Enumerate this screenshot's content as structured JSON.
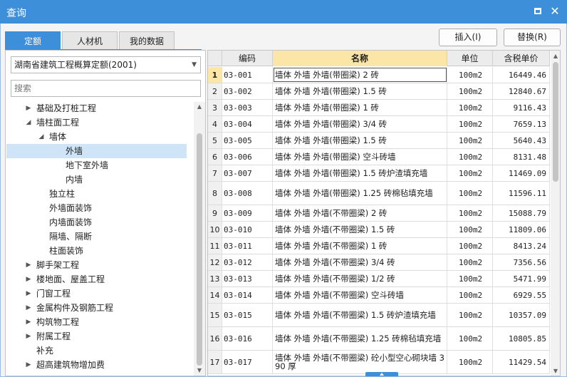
{
  "window": {
    "title": "查询",
    "maximize_icon": "maximize-icon",
    "close_icon": "close-icon",
    "accent": "#3c8fd8"
  },
  "tabs": [
    {
      "label": "定额",
      "active": true
    },
    {
      "label": "人材机",
      "active": false
    },
    {
      "label": "我的数据",
      "active": false
    }
  ],
  "actions": {
    "insert_label": "插入(I)",
    "replace_label": "替换(R)"
  },
  "left": {
    "library_value": "湖南省建筑工程概算定额(2001)",
    "search_placeholder": "搜索",
    "tree": [
      {
        "label": "基础及打桩工程",
        "level": 1,
        "state": "collapsed"
      },
      {
        "label": "墙柱面工程",
        "level": 1,
        "state": "expanded"
      },
      {
        "label": "墙体",
        "level": 2,
        "state": "expanded"
      },
      {
        "label": "外墙",
        "level": 3,
        "state": "leaf",
        "selected": true
      },
      {
        "label": "地下室外墙",
        "level": 3,
        "state": "leaf"
      },
      {
        "label": "内墙",
        "level": 3,
        "state": "leaf"
      },
      {
        "label": "独立柱",
        "level": 2,
        "state": "leaf"
      },
      {
        "label": "外墙面装饰",
        "level": 2,
        "state": "leaf"
      },
      {
        "label": "内墙面装饰",
        "level": 2,
        "state": "leaf"
      },
      {
        "label": "隔墙、隔断",
        "level": 2,
        "state": "leaf"
      },
      {
        "label": "柱面装饰",
        "level": 2,
        "state": "leaf"
      },
      {
        "label": "脚手架工程",
        "level": 1,
        "state": "collapsed"
      },
      {
        "label": "楼地面、屋盖工程",
        "level": 1,
        "state": "collapsed"
      },
      {
        "label": "门窗工程",
        "level": 1,
        "state": "collapsed"
      },
      {
        "label": "金属构件及钢筋工程",
        "level": 1,
        "state": "collapsed"
      },
      {
        "label": "构筑物工程",
        "level": 1,
        "state": "collapsed"
      },
      {
        "label": "附属工程",
        "level": 1,
        "state": "collapsed"
      },
      {
        "label": "补充",
        "level": 1,
        "state": "leaf"
      },
      {
        "label": "超高建筑物增加费",
        "level": 1,
        "state": "collapsed"
      }
    ]
  },
  "grid": {
    "columns": [
      "编码",
      "名称",
      "单位",
      "含税单价"
    ],
    "rows": [
      {
        "num": "1",
        "code": "03-001",
        "name": "墙体 外墙 外墙(带圈梁) 2 砖",
        "unit": "100m2",
        "price": "16449.46",
        "tall": false
      },
      {
        "num": "2",
        "code": "03-002",
        "name": "墙体 外墙 外墙(带圈梁) 1.5 砖",
        "unit": "100m2",
        "price": "12840.67",
        "tall": false
      },
      {
        "num": "3",
        "code": "03-003",
        "name": "墙体 外墙 外墙(带圈梁) 1 砖",
        "unit": "100m2",
        "price": "9116.43",
        "tall": false
      },
      {
        "num": "4",
        "code": "03-004",
        "name": "墙体 外墙 外墙(带圈梁) 3/4 砖",
        "unit": "100m2",
        "price": "7659.13",
        "tall": false
      },
      {
        "num": "5",
        "code": "03-005",
        "name": "墙体 外墙 外墙(带圈梁) 1.5 砖",
        "unit": "100m2",
        "price": "5640.43",
        "tall": false
      },
      {
        "num": "6",
        "code": "03-006",
        "name": "墙体 外墙 外墙(带圈梁) 空斗砖墙",
        "unit": "100m2",
        "price": "8131.48",
        "tall": false
      },
      {
        "num": "7",
        "code": "03-007",
        "name": "墙体 外墙 外墙(带圈梁) 1.5 砖炉渣填充墙",
        "unit": "100m2",
        "price": "11469.09",
        "tall": false
      },
      {
        "num": "8",
        "code": "03-008",
        "name": "墙体 外墙 外墙(带圈梁) 1.25 砖棉毡填充墙",
        "unit": "100m2",
        "price": "11596.11",
        "tall": true
      },
      {
        "num": "9",
        "code": "03-009",
        "name": "墙体 外墙 外墙(不带圈梁) 2 砖",
        "unit": "100m2",
        "price": "15088.79",
        "tall": false
      },
      {
        "num": "10",
        "code": "03-010",
        "name": "墙体 外墙 外墙(不带圈梁) 1.5 砖",
        "unit": "100m2",
        "price": "11809.06",
        "tall": false
      },
      {
        "num": "11",
        "code": "03-011",
        "name": "墙体 外墙 外墙(不带圈梁) 1 砖",
        "unit": "100m2",
        "price": "8413.24",
        "tall": false
      },
      {
        "num": "12",
        "code": "03-012",
        "name": "墙体 外墙 外墙(不带圈梁) 3/4 砖",
        "unit": "100m2",
        "price": "7356.56",
        "tall": false
      },
      {
        "num": "13",
        "code": "03-013",
        "name": "墙体 外墙 外墙(不带圈梁) 1/2 砖",
        "unit": "100m2",
        "price": "5471.99",
        "tall": false
      },
      {
        "num": "14",
        "code": "03-014",
        "name": "墙体 外墙 外墙(不带圈梁) 空斗砖墙",
        "unit": "100m2",
        "price": "6929.55",
        "tall": false
      },
      {
        "num": "15",
        "code": "03-015",
        "name": "墙体 外墙 外墙(不带圈梁) 1.5 砖炉渣填充墙",
        "unit": "100m2",
        "price": "10357.09",
        "tall": true
      },
      {
        "num": "16",
        "code": "03-016",
        "name": "墙体 外墙 外墙(不带圈梁) 1.25 砖棉毡填充墙",
        "unit": "100m2",
        "price": "10805.85",
        "tall": true
      },
      {
        "num": "17",
        "code": "03-017",
        "name": "墙体 外墙 外墙(不带圈梁) 砼小型空心砌块墙 390 厚",
        "unit": "100m2",
        "price": "11429.54",
        "tall": true
      }
    ]
  }
}
